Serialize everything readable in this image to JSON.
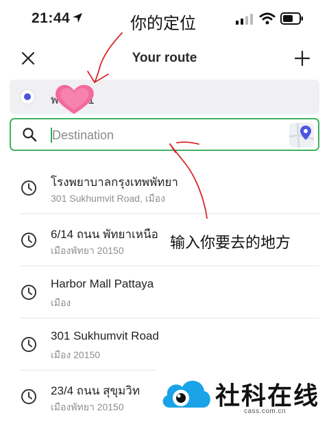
{
  "status_bar": {
    "time": "21:44"
  },
  "annotations": {
    "top": "你的定位",
    "middle": "输入你要去的地方"
  },
  "header": {
    "title": "Your route"
  },
  "origin": {
    "text": "พรวิถี 21"
  },
  "destination": {
    "placeholder": "Destination",
    "value": ""
  },
  "history": [
    {
      "title": "โรงพยาบาลกรุงเทพพัทยา",
      "subtitle": "301 Sukhumvit Road, เมือง"
    },
    {
      "title": "6/14 ถนน พัทยาเหนือ",
      "subtitle": "เมืองพัทยา 20150"
    },
    {
      "title": "Harbor Mall Pattaya",
      "subtitle": "เมือง"
    },
    {
      "title": "301 Sukhumvit Road",
      "subtitle": "เมือง 20150"
    },
    {
      "title": "23/4 ถนน สุขุมวิท",
      "subtitle": "เมืองพัทยา 20150"
    }
  ],
  "watermark": {
    "name": "社科在线",
    "url": "cass.com.cn"
  },
  "colors": {
    "accent_green": "#3fb15e",
    "origin_blue": "#4a55e0",
    "annotation_red": "#d9262a"
  }
}
